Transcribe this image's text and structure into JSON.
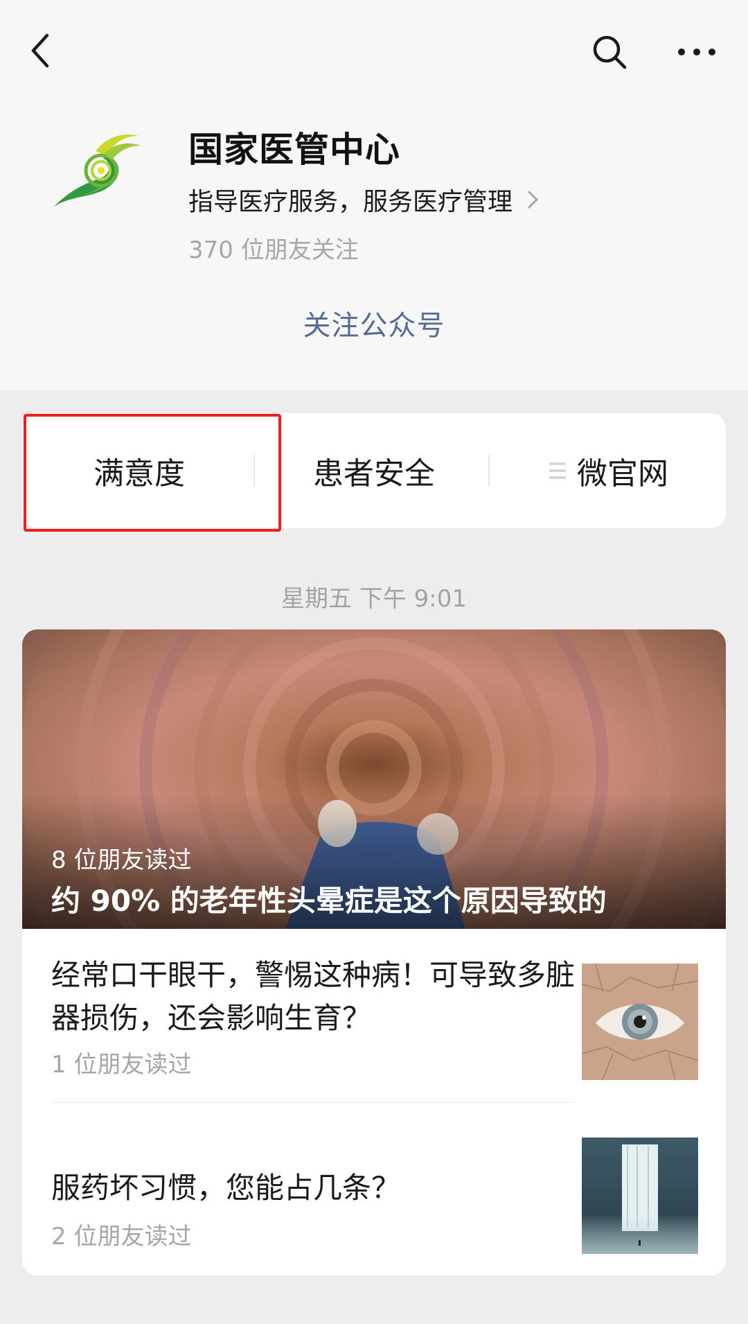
{
  "nav": {
    "back_icon": "chevron-left-icon",
    "search_icon": "search-icon",
    "more_icon": "more-horizontal-icon"
  },
  "account": {
    "name": "国家医管中心",
    "description": "指导医疗服务，服务医疗管理",
    "followers": "370 位朋友关注",
    "follow_button": "关注公众号"
  },
  "menu": {
    "items": [
      {
        "label": "满意度"
      },
      {
        "label": "患者安全"
      },
      {
        "label": "微官网",
        "icon": "list-icon"
      }
    ]
  },
  "feed": {
    "timestamp": "星期五 下午 9:01",
    "hero": {
      "reads": "8 位朋友读过",
      "title": "约 90% 的老年性头晕症是这个原因导致的"
    },
    "articles": [
      {
        "title": "经常口干眼干，警惕这种病！可导致多脏器损伤，还会影响生育？",
        "reads": "1 位朋友读过"
      },
      {
        "title": "服药坏习惯，您能占几条？",
        "reads": "2 位朋友读过"
      }
    ]
  },
  "colors": {
    "link": "#566b94",
    "highlight": "#f01e1e",
    "page_bg": "#ededed"
  }
}
